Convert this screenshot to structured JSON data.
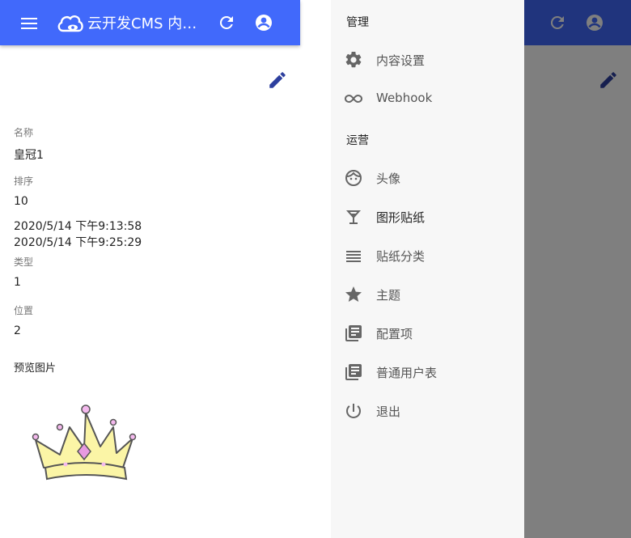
{
  "app": {
    "title": "云开发CMS 内容..."
  },
  "detail": {
    "fields": [
      {
        "label": "名称",
        "value": "皇冠1"
      },
      {
        "label": "排序",
        "value": "10"
      },
      {
        "label": "类型",
        "value": "1"
      },
      {
        "label": "位置",
        "value": "2"
      }
    ],
    "created_at": "2020/5/14 下午9:13:58",
    "updated_at": "2020/5/14 下午9:25:29",
    "preview_label": "预览图片"
  },
  "drawer": {
    "section_admin": "管理",
    "section_ops": "运营",
    "admin_items": [
      {
        "label": "内容设置",
        "icon": "gear-icon"
      },
      {
        "label": "Webhook",
        "icon": "infinity-icon"
      }
    ],
    "ops_items": [
      {
        "label": "头像",
        "icon": "face-icon"
      },
      {
        "label": "图形贴纸",
        "icon": "cocktail-icon"
      },
      {
        "label": "贴纸分类",
        "icon": "list-lines-icon"
      },
      {
        "label": "主题",
        "icon": "star-icon"
      },
      {
        "label": "配置项",
        "icon": "library-books-icon"
      },
      {
        "label": "普通用户表",
        "icon": "library-books-icon"
      },
      {
        "label": "退出",
        "icon": "power-icon"
      }
    ]
  },
  "colors": {
    "primary": "#4169fb",
    "drawer_bg": "#f7f7f7",
    "icon_gray": "#666666",
    "edit_blue": "#2d3f9e"
  }
}
